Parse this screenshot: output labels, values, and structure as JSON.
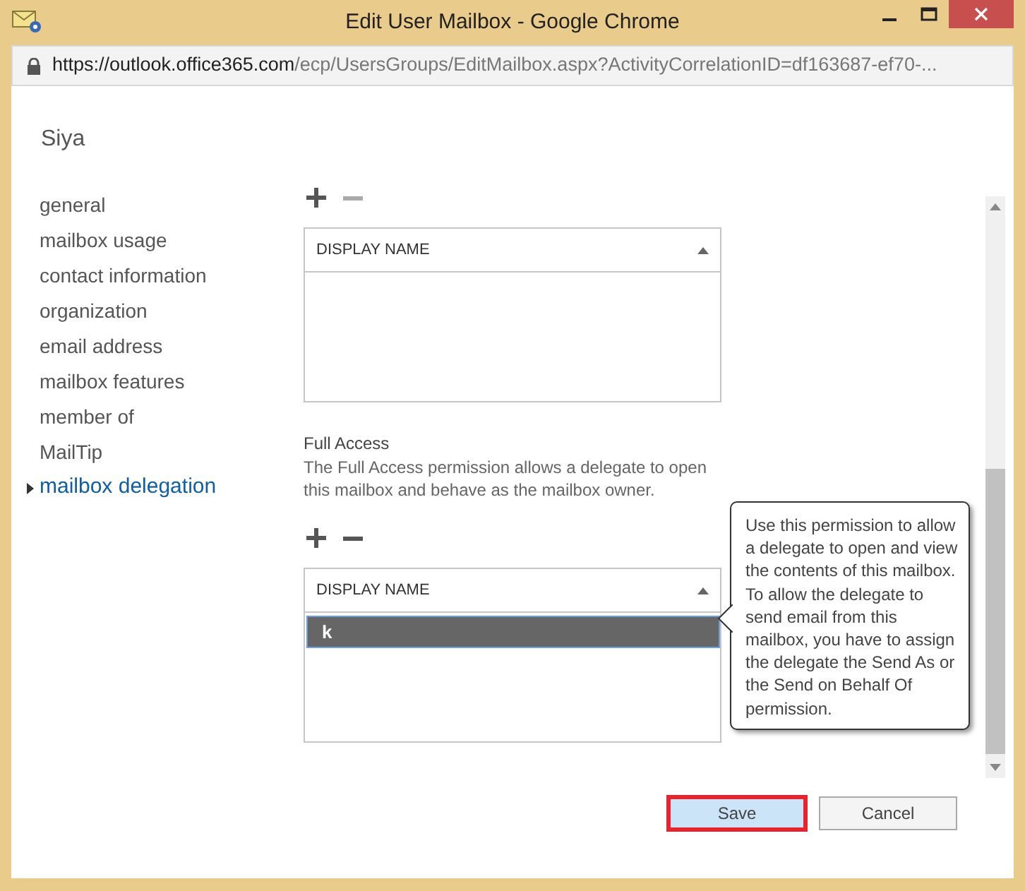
{
  "window": {
    "title": "Edit User Mailbox - Google Chrome"
  },
  "address_bar": {
    "host": "https://outlook.office365.com",
    "path": "/ecp/UsersGroups/EditMailbox.aspx?ActivityCorrelationID=df163687-ef70-..."
  },
  "page_title": "Siya",
  "sidebar": {
    "items": [
      {
        "label": "general",
        "selected": false
      },
      {
        "label": "mailbox usage",
        "selected": false
      },
      {
        "label": "contact information",
        "selected": false
      },
      {
        "label": "organization",
        "selected": false
      },
      {
        "label": "email address",
        "selected": false
      },
      {
        "label": "mailbox features",
        "selected": false
      },
      {
        "label": "member of",
        "selected": false
      },
      {
        "label": "MailTip",
        "selected": false
      },
      {
        "label": "mailbox delegation",
        "selected": true
      }
    ]
  },
  "sections": [
    {
      "remove_disabled": true,
      "column": "DISPLAY NAME"
    },
    {
      "title": "Full Access",
      "description": "The Full Access permission allows a delegate to open this mailbox and behave as the mailbox owner.",
      "remove_disabled": false,
      "column": "DISPLAY NAME",
      "rows": [
        {
          "name": "k",
          "selected": true
        }
      ]
    }
  ],
  "tooltip": "Use this permission to allow a delegate to open and view the contents of this mailbox. To allow the delegate to send email from this mailbox, you have to assign the delegate the Send As or the Send on Behalf Of permission.",
  "buttons": [
    {
      "label": "Save",
      "kind": "primary"
    },
    {
      "label": "Cancel",
      "kind": "secondary"
    }
  ]
}
